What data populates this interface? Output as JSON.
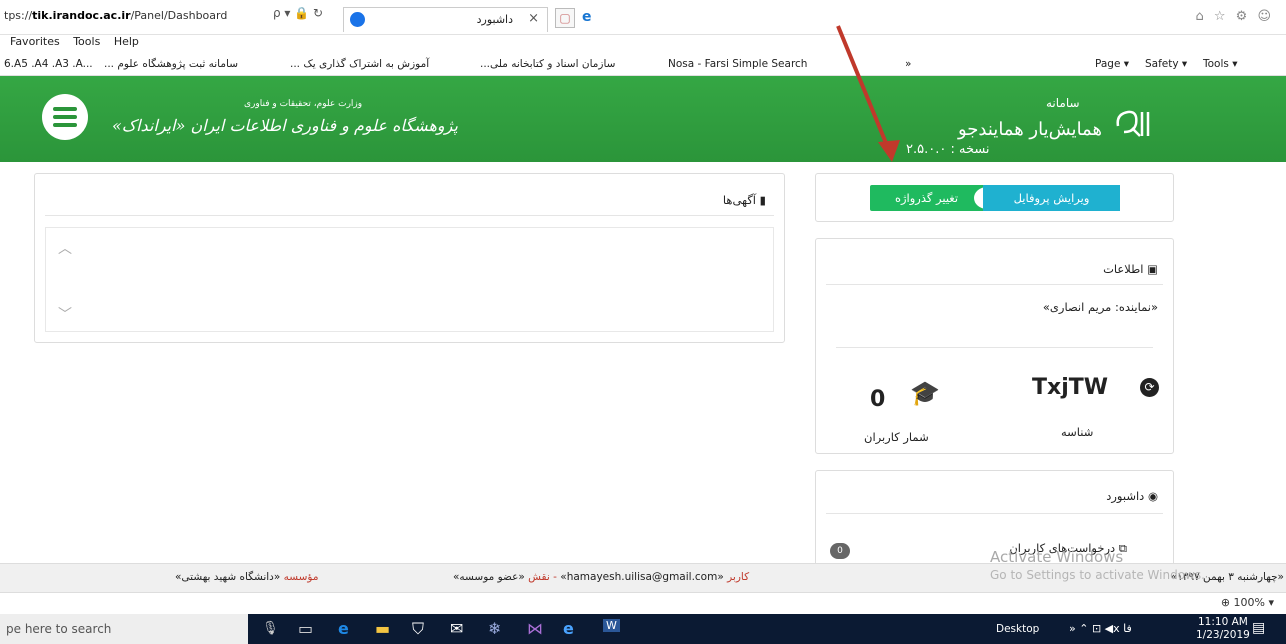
{
  "browser": {
    "url_prefix": "tps://",
    "url_host": "tik.irandoc.ac.ir",
    "url_path": "/Panel/Dashboard",
    "tab_title": "داشبورد",
    "addr_controls": "ρ ▾ 🔒 ↻",
    "tab_close": "×",
    "newtab_icon": "▢",
    "ie_icon": "e",
    "top_right_icons": "⌂ ☆ ⚙ ☺",
    "menu": [
      "Favorites",
      "Tools",
      "Help"
    ],
    "favorites": [
      "6.A5 .A4 .A3 .A...",
      "سامانه ثبت پژوهشگاه علوم ...",
      "آموزش به اشتراک گذاری یک ...",
      "سازمان اسناد و کتابخانه ملی...",
      "Nosa - Farsi Simple Search"
    ],
    "more_chevron": "»",
    "commands": [
      "Page ▾",
      "Safety ▾",
      "Tools ▾"
    ],
    "zoom": "⊕ 100%  ▾"
  },
  "header": {
    "ministry": "وزارت علوم، تحقیقات و فناوری",
    "institute": "پژوهشگاه علوم و فناوری اطلاعات ایران «ایرانداک»",
    "system_label": "سامانه",
    "system_name": "همایش‌یار همایندجو",
    "version": "نسخه : ۲.۵.۰.۰"
  },
  "news": {
    "title": "آگهی‌ها",
    "icon": "▮"
  },
  "profile": {
    "edit_profile": "ویرایش پروفایل",
    "change_password": "تغییر گذرواژه"
  },
  "info": {
    "title": "اطلاعات",
    "representative": "«نماینده: مریم انصاری»",
    "id_value": "TxjTW",
    "id_label": "شناسه",
    "user_count": "0",
    "user_count_label": "شمار کاربران"
  },
  "dashboard": {
    "title": "داشبورد",
    "user_requests": "درخواست‌های کاربران",
    "badge": "0"
  },
  "footer": {
    "date": "«چهارشنبه ۳ بهمن ۱۳۹۷»",
    "user_label": "کاربر",
    "user_value": "«hamayesh.uilisa@gmail.com»",
    "role_label": "- نقش",
    "role_value": "«عضو موسسه»",
    "inst_label": "مؤسسه",
    "inst_value": "«دانشگاه شهید بهشتی»"
  },
  "watermark": {
    "line1": "Activate Windows",
    "line2": "Go to Settings to activate Windows."
  },
  "taskbar": {
    "search_placeholder": "pe here to search",
    "desktop": "Desktop",
    "tray": "»   ⌃  ⊡  ◀x   فا",
    "time": "11:10 AM",
    "date": "1/23/2019"
  },
  "colors": {
    "header_green": "#2e9e3e",
    "btn_green": "#1fba5f",
    "btn_cyan": "#1fb1d0",
    "arrow": "#c0392b"
  }
}
